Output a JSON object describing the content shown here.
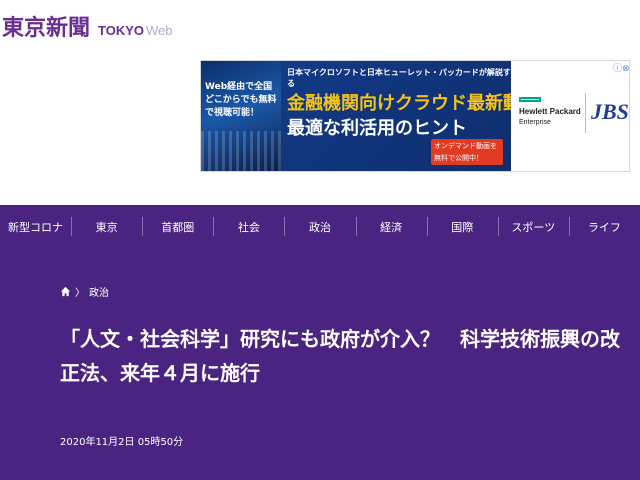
{
  "header": {
    "logo_jp": "東京新聞",
    "logo_en": "TOKYO",
    "logo_web": "Web"
  },
  "ad": {
    "web_text": "Web経由で全国どこからでも無料で視聴可能！",
    "top_text": "日本マイクロソフトと日本ヒューレット・パッカードが解説する",
    "headline_1": "金融機関向けクラウド最新動向と",
    "headline_2": "最適な利活用のヒント",
    "cta": "オンデマンド動画を無料で公開中！",
    "hpe_line1": "Hewlett Packard",
    "hpe_line2": "Enterprise",
    "jbs": "JBS",
    "close": "ⓘ⊗"
  },
  "nav": {
    "items": [
      "新型コロナ",
      "東京",
      "首都圏",
      "社会",
      "政治",
      "経済",
      "国際",
      "スポーツ",
      "ライフ"
    ]
  },
  "article": {
    "breadcrumb_section": "政治",
    "headline": "「人文・社会科学」研究にも政府が介入？　科学技術振興の改正法、来年４月に施行",
    "date": "2020年11月2日 05時50分"
  },
  "colors": {
    "brand_purple": "#4b2381",
    "logo_purple": "#6a2d91"
  },
  "icons": {
    "home": "home-icon",
    "breadcrumb_separator": "chevron-right-icon"
  }
}
